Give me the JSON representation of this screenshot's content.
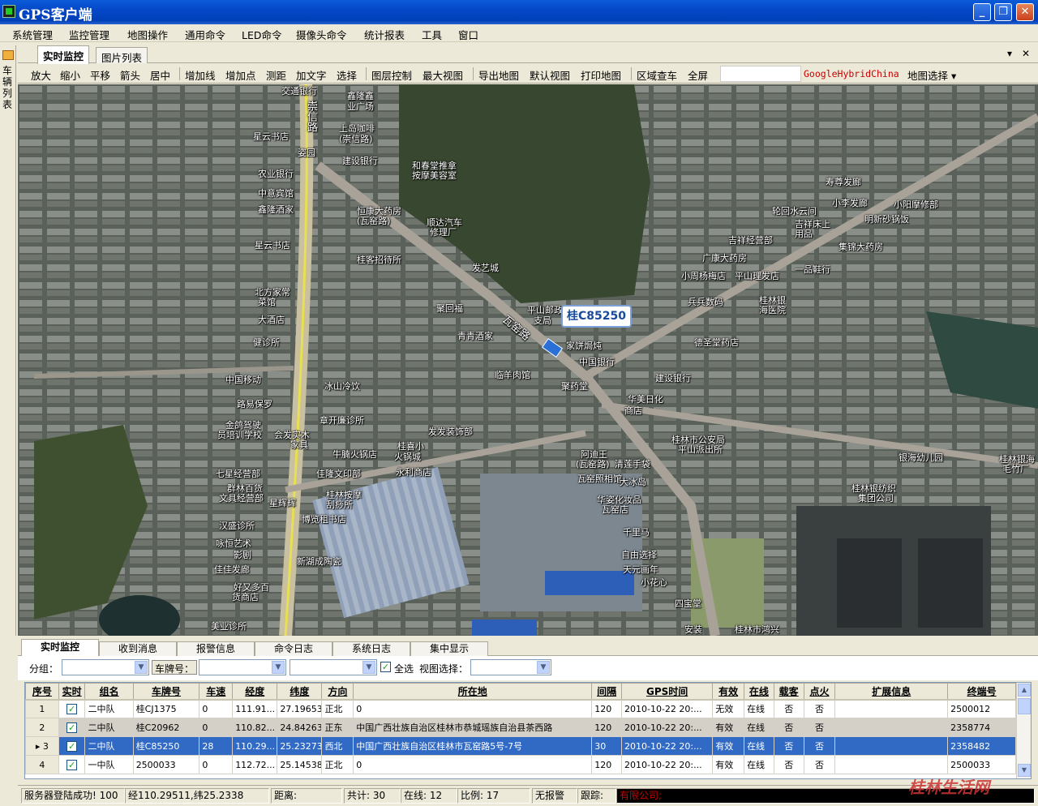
{
  "window": {
    "title": "GPS客户端"
  },
  "menu": [
    "系统管理",
    "监控管理",
    "地图操作",
    "通用命令",
    "LED命令",
    "摄像头命令",
    "统计报表",
    "工具",
    "窗口"
  ],
  "left_panel_label": "车辆列表",
  "top_tabs": [
    "实时监控",
    "图片列表"
  ],
  "toolbar": {
    "buttons": [
      "放大",
      "缩小",
      "平移",
      "箭头",
      "居中",
      "增加线",
      "增加点",
      "测距",
      "加文字",
      "选择",
      "图层控制",
      "最大视图",
      "导出地图",
      "默认视图",
      "打印地图",
      "区域查车",
      "全屏"
    ],
    "map_type": "GoogleHybridChina",
    "map_select": "地图选择"
  },
  "map": {
    "vehicle_label": "桂C85250",
    "labels": [
      "交通银行",
      "鑫隆鑫",
      "业广场",
      "崇信路",
      "上岛咖啡",
      "(崇信路)",
      "星云书店",
      "姿园",
      "建设银行",
      "和春堂推拿",
      "按摩美容室",
      "农业银行",
      "中意宾馆",
      "鑫隆酒家",
      "恒康大药房",
      "(瓦窑路)",
      "顺达汽车",
      "修理厂",
      "星云书店",
      "桂客招待所",
      "发艺城",
      "北方家常",
      "菜馆",
      "聚回福",
      "大酒店",
      "平山邮政",
      "支局",
      "瓦窑路",
      "青青酒家",
      "家饼焗炖",
      "中国银行",
      "健诊所",
      "中国移动",
      "冰山冷饮",
      "临羊肉馆",
      "聚药堂",
      "路易保罗",
      "建设银行",
      "章开廉诊所",
      "金鸽驾驶",
      "员培训学校",
      "会发实木",
      "家具",
      "发发装饰部",
      "牛腩火锅店",
      "桂喜小",
      "火锅城",
      "永利商店",
      "七星经营部",
      "佳隆文印部",
      "群林百货",
      "文具经营部",
      "星辉辉",
      "桂林按摩",
      "刮痧所",
      "汉盛诊所",
      "博览租书店",
      "新湖成陶瓷",
      "咏恒艺术",
      "影剧",
      "佳佳发廊",
      "好又多百",
      "货商店",
      "美业诊所",
      "吉祥经营部",
      "广康大药房",
      "小周杨梅店",
      "平山理发店",
      "桂林银",
      "海医院",
      "兵兵数码",
      "德圣堂药店",
      "寿尊发廊",
      "小李发廊",
      "轮回水云间",
      "吉祥床上",
      "用品",
      "集锦大药房",
      "一品鞋行",
      "明新砂锅饭",
      "小阳摩修部",
      "桂林市公安局",
      "平山派出所",
      "银海幼儿园",
      "桂林银海",
      "毛竹厂",
      "桂林银纺织",
      "集团公司",
      "阿迪王",
      "(瓦窑路)",
      "瓦窑照相馆",
      "清莲手袋",
      "大冰岛",
      "华姿化妆品",
      "瓦窑店",
      "千里马",
      "自由选择",
      "天元画年",
      "小花心",
      "四宝堂",
      "桂林市鸿兴",
      "安装",
      "华美日化",
      "商店"
    ]
  },
  "bottom_tabs": [
    "实时监控",
    "收到消息",
    "报警信息",
    "命令日志",
    "系统日志",
    "集中显示"
  ],
  "filters": {
    "group_label": "分组：",
    "plate_label": "车牌号：",
    "select_all": "全选",
    "view_label": "视图选择："
  },
  "grid": {
    "columns": [
      "序号",
      "实时",
      "组名",
      "车牌号",
      "车速",
      "经度",
      "纬度",
      "方向",
      "所在地",
      "间隔",
      "GPS时间",
      "有效",
      "在线",
      "载客",
      "点火",
      "扩展信息",
      "终端号"
    ],
    "rows": [
      {
        "no": "1",
        "group": "二中队",
        "plate": "桂CJ1375",
        "speed": "0",
        "lng": "111.91...",
        "lat": "27.19653",
        "dir": "正北",
        "loc": "0",
        "interval": "120",
        "time": "2010-10-22 20:...",
        "valid": "无效",
        "online": "在线",
        "carry": "否",
        "ign": "否",
        "ext": "",
        "term": "2500012"
      },
      {
        "no": "2",
        "group": "二中队",
        "plate": "桂C20962",
        "speed": "0",
        "lng": "110.82...",
        "lat": "24.84263",
        "dir": "正东",
        "loc": "中国广西壮族自治区桂林市恭城瑶族自治县茶西路",
        "interval": "120",
        "time": "2010-10-22 20:...",
        "valid": "有效",
        "online": "在线",
        "carry": "否",
        "ign": "否",
        "ext": "",
        "term": "2358774"
      },
      {
        "no": "3",
        "group": "二中队",
        "plate": "桂C85250",
        "speed": "28",
        "lng": "110.29...",
        "lat": "25.23273",
        "dir": "西北",
        "loc": "中国广西壮族自治区桂林市瓦窑路5号-7号",
        "interval": "30",
        "time": "2010-10-22 20:...",
        "valid": "有效",
        "online": "在线",
        "carry": "否",
        "ign": "否",
        "ext": "",
        "term": "2358482"
      },
      {
        "no": "4",
        "group": "一中队",
        "plate": "2500033",
        "speed": "0",
        "lng": "112.72...",
        "lat": "25.14538",
        "dir": "正北",
        "loc": "0",
        "interval": "120",
        "time": "2010-10-22 20:...",
        "valid": "有效",
        "online": "在线",
        "carry": "否",
        "ign": "否",
        "ext": "",
        "term": "2500033"
      }
    ]
  },
  "status": {
    "login": "服务器登陆成功! 100",
    "coords": "经110.29511,纬25.2338",
    "distance": "距离:",
    "total": "共计: 30",
    "online": "在线: 12",
    "ratio": "比例: 17",
    "alarm": "无报警",
    "track": "跟踪:",
    "company": "有限公司;"
  },
  "watermark": "桂林生活网"
}
